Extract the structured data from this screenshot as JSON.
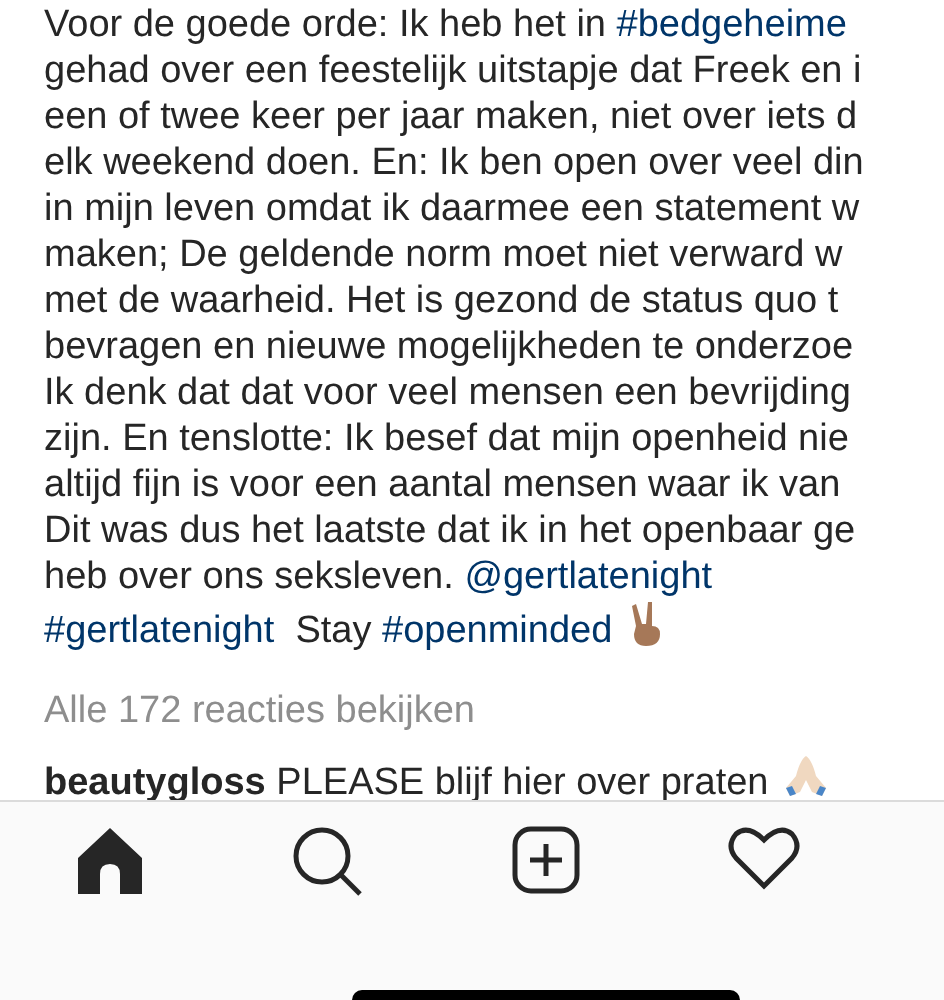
{
  "caption_lines": [
    [
      {
        "kind": "text",
        "text": "Voor de goede orde: Ik heb het in "
      },
      {
        "kind": "link",
        "text": "#bedgeheime"
      }
    ],
    [
      {
        "kind": "text",
        "text": "gehad over een feestelijk uitstapje dat Freek en i"
      }
    ],
    [
      {
        "kind": "text",
        "text": "een of twee keer per jaar maken, niet over iets d"
      }
    ],
    [
      {
        "kind": "text",
        "text": "elk weekend doen. En: Ik ben open over veel din"
      }
    ],
    [
      {
        "kind": "text",
        "text": "in mijn leven omdat ik daarmee een statement w"
      }
    ],
    [
      {
        "kind": "text",
        "text": "maken; De geldende norm moet niet verward w"
      }
    ],
    [
      {
        "kind": "text",
        "text": "met de waarheid. Het is gezond de status quo t"
      }
    ],
    [
      {
        "kind": "text",
        "text": "bevragen en nieuwe mogelijkheden te onderzoe"
      }
    ],
    [
      {
        "kind": "text",
        "text": "Ik denk dat dat voor veel mensen een bevrijding"
      }
    ],
    [
      {
        "kind": "text",
        "text": "zijn. En tenslotte: Ik besef dat mijn openheid nie"
      }
    ],
    [
      {
        "kind": "text",
        "text": "altijd fijn is voor een aantal mensen waar ik van"
      }
    ],
    [
      {
        "kind": "text",
        "text": "Dit was dus het laatste dat ik in het openbaar ge"
      }
    ],
    [
      {
        "kind": "text",
        "text": "heb over ons seksleven. "
      },
      {
        "kind": "link",
        "text": "@gertlatenight"
      }
    ],
    [
      {
        "kind": "link",
        "text": "#gertlatenight"
      },
      {
        "kind": "text",
        "text": "  Stay "
      },
      {
        "kind": "link",
        "text": "#openminded"
      },
      {
        "kind": "peace_emoji"
      }
    ]
  ],
  "view_comments": "Alle 172 reacties bekijken",
  "comment": {
    "username": "beautygloss",
    "text": "PLEASE blijf hier over praten"
  },
  "tab_bar": [
    {
      "kind": "home",
      "selected": true
    },
    {
      "kind": "search",
      "selected": false
    },
    {
      "kind": "add",
      "selected": false
    },
    {
      "kind": "activity",
      "selected": false
    }
  ]
}
